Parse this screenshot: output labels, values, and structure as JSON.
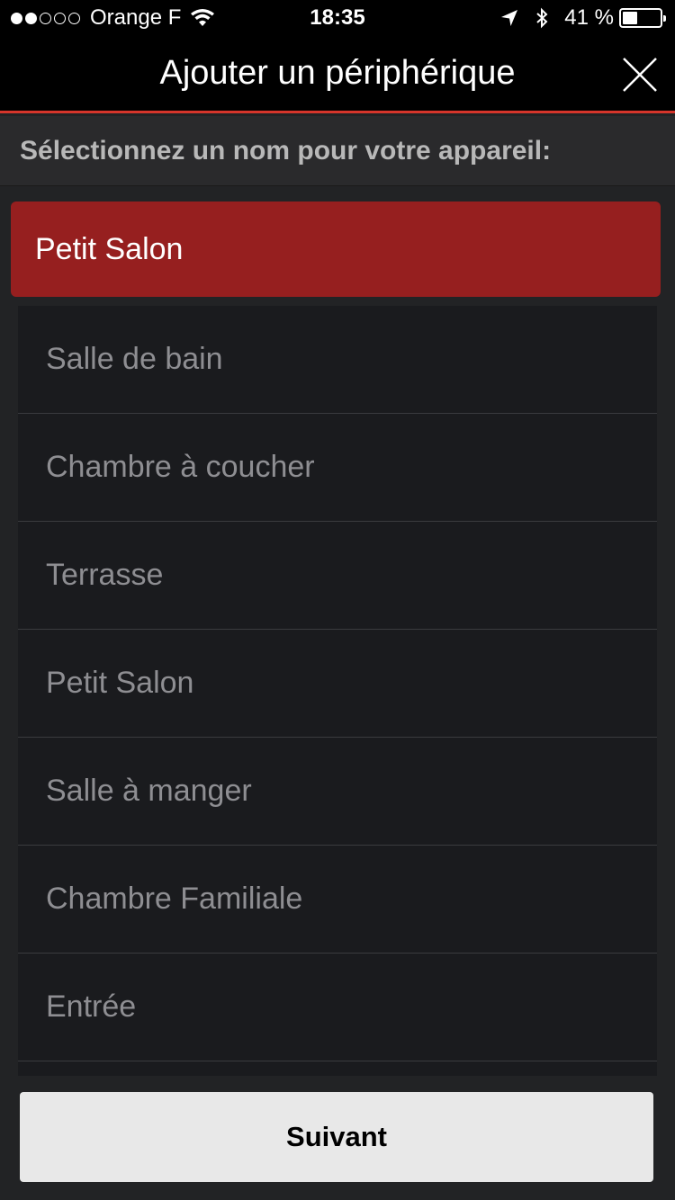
{
  "status_bar": {
    "carrier": "Orange F",
    "signal_bars_filled": 2,
    "signal_bars_total": 5,
    "time": "18:35",
    "battery_text": "41 %",
    "battery_level": 0.41
  },
  "header": {
    "title": "Ajouter un périphérique",
    "close_icon": "close-icon",
    "accent_color": "#d6352b"
  },
  "subtitle": "Sélectionnez un nom pour votre appareil:",
  "selected": {
    "label": "Petit Salon",
    "color": "#961f1f"
  },
  "list": {
    "items": [
      {
        "label": "Salle de bain"
      },
      {
        "label": "Chambre à coucher"
      },
      {
        "label": "Terrasse"
      },
      {
        "label": "Petit Salon"
      },
      {
        "label": "Salle à manger"
      },
      {
        "label": "Chambre Familiale"
      },
      {
        "label": "Entrée"
      }
    ]
  },
  "footer": {
    "next_label": "Suivant"
  }
}
